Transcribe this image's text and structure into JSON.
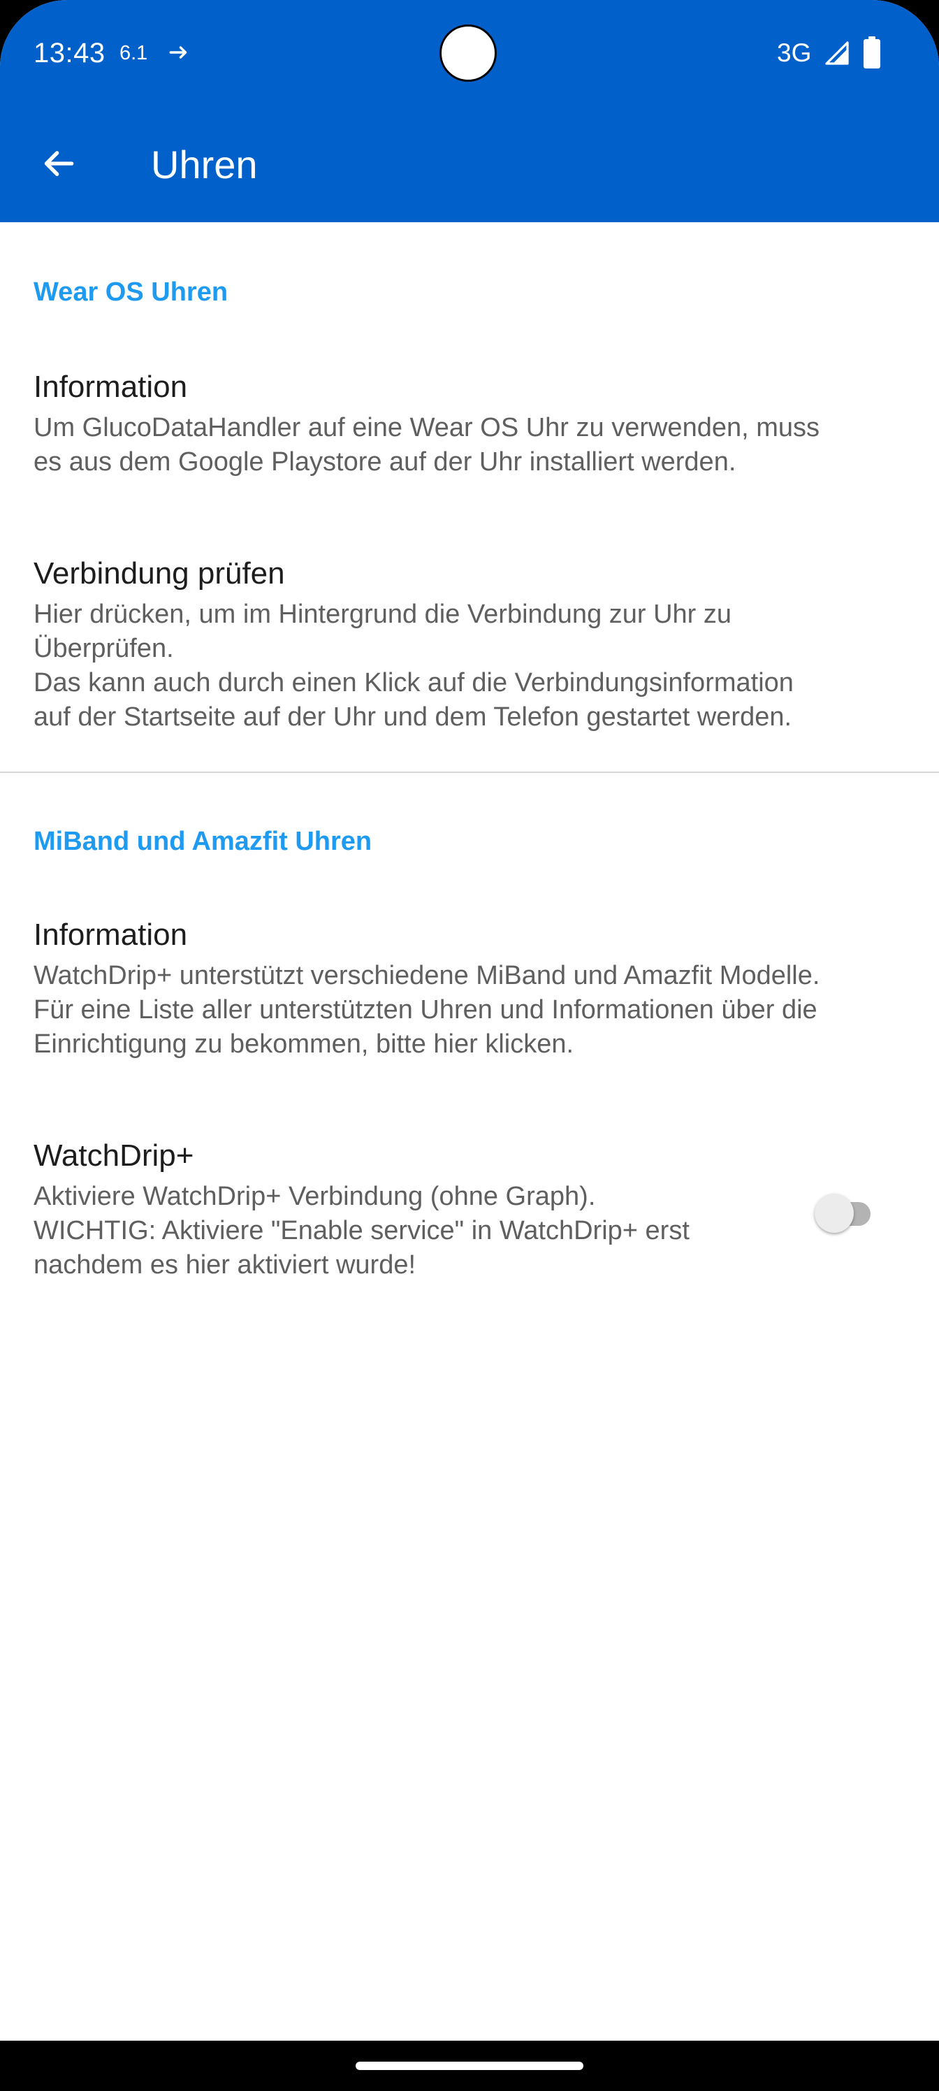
{
  "status_bar": {
    "time": "13:43",
    "extra": "6.1",
    "network": "3G",
    "icons": [
      "arrow-right-icon",
      "signal-icon",
      "battery-icon"
    ]
  },
  "toolbar": {
    "title": "Uhren",
    "back_icon": "arrow-back-icon",
    "background_color": "#0260CA"
  },
  "sections": [
    {
      "category": "Wear OS Uhren",
      "items": [
        {
          "title": "Information",
          "summary": "Um GlucoDataHandler auf eine Wear OS Uhr zu verwenden, muss\nes aus dem Google Playstore auf der Uhr installiert werden."
        },
        {
          "title": "Verbindung prüfen",
          "summary": "Hier drücken, um im Hintergrund die Verbindung zur Uhr zu\nÜberprüfen.\nDas kann auch durch einen Klick auf die Verbindungsinformation\nauf der Startseite auf der Uhr und dem Telefon gestartet werden."
        }
      ]
    },
    {
      "category": "MiBand und Amazfit Uhren",
      "items": [
        {
          "title": "Information",
          "summary": "WatchDrip+ unterstützt verschiedene MiBand und Amazfit Modelle.\nFür eine Liste aller unterstützten Uhren und Informationen über die\nEinrichtigung zu bekommen, bitte hier klicken."
        },
        {
          "title": "WatchDrip+",
          "summary": "Aktiviere WatchDrip+ Verbindung (ohne Graph).\nWICHTIG: Aktiviere \"Enable service\" in WatchDrip+ erst\nnachdem es hier aktiviert wurde!",
          "switch_on": false
        }
      ]
    }
  ],
  "colors": {
    "accent": "#1E9AF0",
    "title_text": "#1d1d1d",
    "summary_text": "#5f5f5f"
  }
}
